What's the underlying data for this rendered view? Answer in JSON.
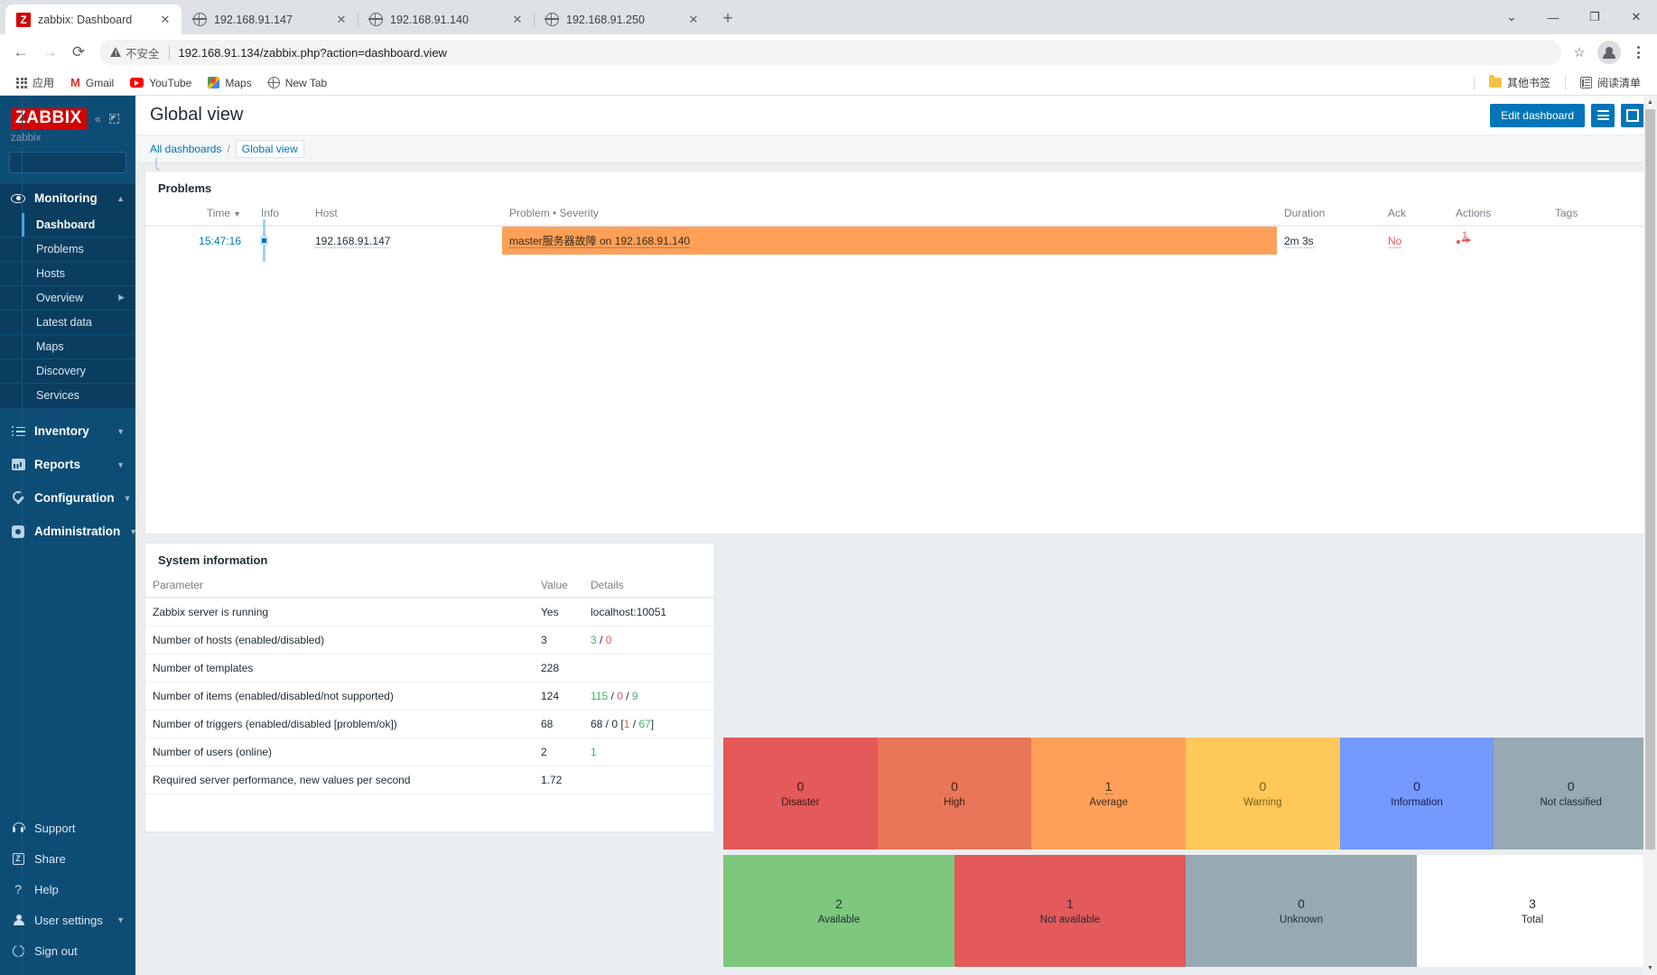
{
  "browser": {
    "tabs": [
      {
        "title": "zabbix: Dashboard",
        "icon": "zabbix-favicon",
        "active": true
      },
      {
        "title": "192.168.91.147",
        "icon": "globe-icon",
        "active": false
      },
      {
        "title": "192.168.91.140",
        "icon": "globe-icon",
        "active": false
      },
      {
        "title": "192.168.91.250",
        "icon": "globe-icon",
        "active": false
      }
    ],
    "new_tab_label": "+",
    "window_controls": {
      "collapse": "⌄",
      "minimize": "—",
      "maximize": "❐",
      "close": "✕"
    },
    "nav": {
      "back": "←",
      "forward": "→",
      "reload": "⟳"
    },
    "omnibox": {
      "security_label": "不安全",
      "url": "192.168.91.134/zabbix.php?action=dashboard.view",
      "star": "☆"
    },
    "bookmarks": [
      {
        "label": "应用",
        "icon": "apps-grid-icon"
      },
      {
        "label": "Gmail",
        "icon": "gmail-icon"
      },
      {
        "label": "YouTube",
        "icon": "youtube-icon"
      },
      {
        "label": "Maps",
        "icon": "maps-icon"
      },
      {
        "label": "New Tab",
        "icon": "globe-icon"
      }
    ],
    "bookmarks_right": [
      {
        "label": "其他书签",
        "icon": "folder-icon"
      },
      {
        "label": "阅读清单",
        "icon": "reading-list-icon"
      }
    ]
  },
  "sidebar": {
    "logo": "ZABBIX",
    "username": "zabbix",
    "search_placeholder": "",
    "search_value": "",
    "groups": [
      {
        "label": "Monitoring",
        "icon": "eye-icon",
        "expanded": true,
        "items": [
          {
            "label": "Dashboard",
            "active": true
          },
          {
            "label": "Problems",
            "active": false
          },
          {
            "label": "Hosts",
            "active": false
          },
          {
            "label": "Overview",
            "active": false,
            "submenu": true
          },
          {
            "label": "Latest data",
            "active": false
          },
          {
            "label": "Maps",
            "active": false
          },
          {
            "label": "Discovery",
            "active": false
          },
          {
            "label": "Services",
            "active": false
          }
        ]
      },
      {
        "label": "Inventory",
        "icon": "list-icon",
        "expanded": false,
        "items": []
      },
      {
        "label": "Reports",
        "icon": "bar-chart-icon",
        "expanded": false,
        "items": []
      },
      {
        "label": "Configuration",
        "icon": "wrench-icon",
        "expanded": false,
        "items": []
      },
      {
        "label": "Administration",
        "icon": "gear-icon",
        "expanded": false,
        "items": []
      }
    ],
    "bottom": [
      {
        "label": "Support",
        "icon": "headset-icon",
        "chevron": false
      },
      {
        "label": "Share",
        "icon": "zabbix-share-icon",
        "chevron": false
      },
      {
        "label": "Help",
        "icon": "question-icon",
        "chevron": false
      },
      {
        "label": "User settings",
        "icon": "person-icon",
        "chevron": true
      },
      {
        "label": "Sign out",
        "icon": "power-icon",
        "chevron": false
      }
    ]
  },
  "header": {
    "title": "Global view",
    "edit_dashboard_label": "Edit dashboard",
    "menu_icon": "hamburger-icon",
    "kiosk_icon": "fullscreen-icon"
  },
  "breadcrumb": {
    "all_dashboards": "All dashboards",
    "separator": "/",
    "current": "Global view"
  },
  "problems_widget": {
    "title": "Problems",
    "columns": [
      "Time",
      "Info",
      "Host",
      "Problem • Severity",
      "Duration",
      "Ack",
      "Actions",
      "Tags"
    ],
    "sort_indicator": "▼",
    "rows": [
      {
        "time": "15:47:16",
        "info": "",
        "host": "192.168.91.147",
        "problem": "master服务器故障 on 192.168.91.140",
        "duration": "2m 3s",
        "ack": "No",
        "actions": "1",
        "tags": "",
        "severity_color": "#ffa059"
      }
    ]
  },
  "system_information": {
    "title": "System information",
    "columns": [
      "Parameter",
      "Value",
      "Details"
    ],
    "rows": [
      {
        "parameter": "Zabbix server is running",
        "value": "Yes",
        "value_color": "#3db56d",
        "details": "localhost:10051"
      },
      {
        "parameter": "Number of hosts (enabled/disabled)",
        "value": "3",
        "details_parts": [
          {
            "t": "3",
            "c": "#3db56d"
          },
          {
            "t": " / ",
            "c": "#1f2c33"
          },
          {
            "t": "0",
            "c": "#e45959"
          }
        ]
      },
      {
        "parameter": "Number of templates",
        "value": "228",
        "details": ""
      },
      {
        "parameter": "Number of items (enabled/disabled/not supported)",
        "value": "124",
        "details_parts": [
          {
            "t": "115",
            "c": "#3db56d"
          },
          {
            "t": " / ",
            "c": "#1f2c33"
          },
          {
            "t": "0",
            "c": "#e45959"
          },
          {
            "t": " / ",
            "c": "#1f2c33"
          },
          {
            "t": "9",
            "c": "#3db56d"
          }
        ]
      },
      {
        "parameter": "Number of triggers (enabled/disabled [problem/ok])",
        "value": "68",
        "details_parts": [
          {
            "t": "68 / 0 [",
            "c": "#1f2c33"
          },
          {
            "t": "1",
            "c": "#e45959"
          },
          {
            "t": " / ",
            "c": "#1f2c33"
          },
          {
            "t": "67",
            "c": "#3db56d"
          },
          {
            "t": "]",
            "c": "#1f2c33"
          }
        ]
      },
      {
        "parameter": "Number of users (online)",
        "value": "2",
        "details_parts": [
          {
            "t": "1",
            "c": "#3db56d"
          }
        ]
      },
      {
        "parameter": "Required server performance, new values per second",
        "value": "1.72",
        "details": ""
      }
    ]
  },
  "chart_data": [
    {
      "type": "bar",
      "title": "Problems by severity",
      "categories": [
        "Disaster",
        "High",
        "Average",
        "Warning",
        "Information",
        "Not classified"
      ],
      "values": [
        0,
        0,
        1,
        0,
        0,
        0
      ],
      "colors": [
        "#e45959",
        "#e97659",
        "#ffa059",
        "#ffc859",
        "#7499ff",
        "#97aab3"
      ],
      "label_colors": [
        "#3d1616",
        "#3d2016",
        "#3d2a19",
        "#3d3116",
        "#16204d",
        "#1f2c33"
      ]
    },
    {
      "type": "bar",
      "title": "Host availability",
      "categories": [
        "Available",
        "Not available",
        "Unknown",
        "Total"
      ],
      "values": [
        2,
        1,
        0,
        3
      ],
      "colors": [
        "#7dc87d",
        "#e45959",
        "#97aab3",
        "#ffffff"
      ],
      "label_colors": [
        "#1f2c33",
        "#1f2c33",
        "#1f2c33",
        "#1f2c33"
      ]
    }
  ],
  "severity_tiles": [
    {
      "count": "0",
      "label": "Disaster",
      "color": "#e45959",
      "text": "#3d1616",
      "dotted": false
    },
    {
      "count": "0",
      "label": "High",
      "color": "#e97659",
      "text": "#3d2016",
      "dotted": false
    },
    {
      "count": "1",
      "label": "Average",
      "color": "#ffa059",
      "text": "#3d2a19",
      "dotted": true
    },
    {
      "count": "0",
      "label": "Warning",
      "color": "#ffc859",
      "text": "#7a5e16",
      "dotted": false
    },
    {
      "count": "0",
      "label": "Information",
      "color": "#7499ff",
      "text": "#16204d",
      "dotted": false
    },
    {
      "count": "0",
      "label": "Not classified",
      "color": "#97aab3",
      "text": "#1f2c33",
      "dotted": false
    }
  ],
  "availability_tiles": [
    {
      "count": "2",
      "label": "Available",
      "color": "#7dc87d",
      "text": "#1f2c33",
      "dotted": false
    },
    {
      "count": "1",
      "label": "Not available",
      "color": "#e45959",
      "text": "#1f2c33",
      "dotted": false
    },
    {
      "count": "0",
      "label": "Unknown",
      "color": "#97aab3",
      "text": "#1f2c33",
      "dotted": false
    },
    {
      "count": "3",
      "label": "Total",
      "color": "#ffffff",
      "text": "#1f2c33",
      "dotted": false
    }
  ]
}
